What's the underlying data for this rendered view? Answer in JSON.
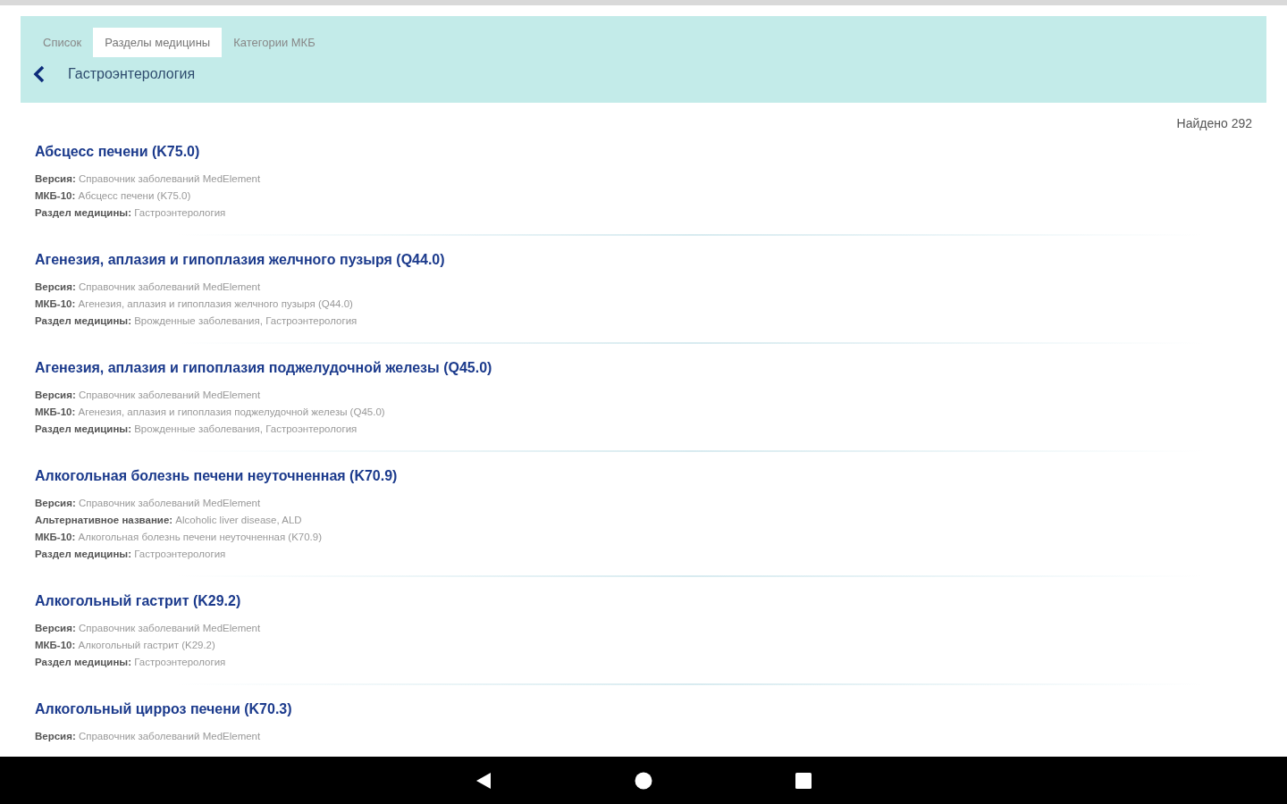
{
  "tabs": [
    {
      "label": "Список",
      "selected": false
    },
    {
      "label": "Разделы медицины",
      "selected": true
    },
    {
      "label": "Категории МКБ",
      "selected": false
    }
  ],
  "section": {
    "title": "Гастроэнтерология"
  },
  "found": "Найдено 292",
  "items": [
    {
      "title": "Абсцесс печени (K75.0)",
      "fields": [
        {
          "label": "Версия:",
          "value": "Справочник заболеваний MedElement"
        },
        {
          "label": "МКБ-10:",
          "value": "Абсцесс печени (K75.0)"
        },
        {
          "label": "Раздел медицины:",
          "value": "Гастроэнтерология"
        }
      ]
    },
    {
      "title": "Агенезия, аплазия и гипоплазия желчного пузыря (Q44.0)",
      "fields": [
        {
          "label": "Версия:",
          "value": "Справочник заболеваний MedElement"
        },
        {
          "label": "МКБ-10:",
          "value": "Агенезия, аплазия и гипоплазия желчного пузыря (Q44.0)"
        },
        {
          "label": "Раздел медицины:",
          "value": "Врожденные заболевания, Гастроэнтерология"
        }
      ]
    },
    {
      "title": "Агенезия, аплазия и гипоплазия поджелудочной железы (Q45.0)",
      "fields": [
        {
          "label": "Версия:",
          "value": "Справочник заболеваний MedElement"
        },
        {
          "label": "МКБ-10:",
          "value": "Агенезия, аплазия и гипоплазия поджелудочной железы (Q45.0)"
        },
        {
          "label": "Раздел медицины:",
          "value": "Врожденные заболевания, Гастроэнтерология"
        }
      ]
    },
    {
      "title": "Алкогольная болезнь печени неуточненная (K70.9)",
      "fields": [
        {
          "label": "Версия:",
          "value": "Справочник заболеваний MedElement"
        },
        {
          "label": "Альтернативное название:",
          "value": "Alcoholic liver disease, ALD"
        },
        {
          "label": "МКБ-10:",
          "value": "Алкогольная болезнь печени неуточненная (K70.9)"
        },
        {
          "label": "Раздел медицины:",
          "value": "Гастроэнтерология"
        }
      ]
    },
    {
      "title": "Алкогольный гастрит (K29.2)",
      "fields": [
        {
          "label": "Версия:",
          "value": "Справочник заболеваний MedElement"
        },
        {
          "label": "МКБ-10:",
          "value": "Алкогольный гастрит (K29.2)"
        },
        {
          "label": "Раздел медицины:",
          "value": "Гастроэнтерология"
        }
      ]
    },
    {
      "title": "Алкогольный цирроз печени (K70.3)",
      "fields": [
        {
          "label": "Версия:",
          "value": "Справочник заболеваний MedElement"
        }
      ]
    }
  ]
}
